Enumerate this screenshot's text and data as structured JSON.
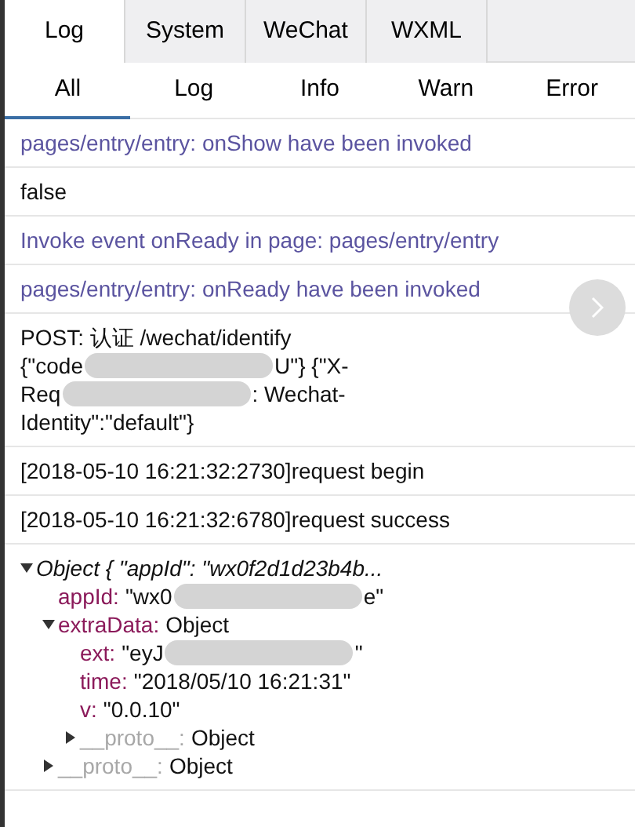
{
  "tabs": [
    {
      "label": "Log",
      "selected": true
    },
    {
      "label": "System",
      "selected": false
    },
    {
      "label": "WeChat",
      "selected": false
    },
    {
      "label": "WXML",
      "selected": false
    }
  ],
  "filters": [
    {
      "label": "All",
      "selected": true
    },
    {
      "label": "Log",
      "selected": false
    },
    {
      "label": "Info",
      "selected": false
    },
    {
      "label": "Warn",
      "selected": false
    },
    {
      "label": "Error",
      "selected": false
    }
  ],
  "logs": [
    {
      "kind": "info",
      "lines": [
        [
          {
            "kind": "text",
            "text": "pages/entry/entry: onShow have been invoked"
          }
        ]
      ]
    },
    {
      "kind": "plain",
      "lines": [
        [
          {
            "kind": "text",
            "text": "false"
          }
        ]
      ]
    },
    {
      "kind": "info",
      "lines": [
        [
          {
            "kind": "text",
            "text": "Invoke event onReady in page: pages/entry/entry"
          }
        ]
      ]
    },
    {
      "kind": "info",
      "lines": [
        [
          {
            "kind": "text",
            "text": "pages/entry/entry: onReady have been invoked"
          }
        ]
      ]
    },
    {
      "kind": "plain",
      "lines": [
        [
          {
            "kind": "text",
            "text": "POST: 认证 /wechat/identify"
          }
        ],
        [
          {
            "kind": "text",
            "text": "{\"code"
          },
          {
            "kind": "redacted"
          },
          {
            "kind": "text",
            "text": "U\"} {\"X-"
          }
        ],
        [
          {
            "kind": "text",
            "text": "Req"
          },
          {
            "kind": "redacted"
          },
          {
            "kind": "text",
            "text": ": Wechat-"
          }
        ],
        [
          {
            "kind": "text",
            "text": "Identity\":\"default\"}"
          }
        ]
      ]
    },
    {
      "kind": "plain",
      "lines": [
        [
          {
            "kind": "text",
            "text": "[2018-05-10 16:21:32:2730]request begin"
          }
        ]
      ]
    },
    {
      "kind": "plain",
      "lines": [
        [
          {
            "kind": "text",
            "text": "[2018-05-10 16:21:32:6780]request success"
          }
        ]
      ]
    },
    {
      "kind": "object",
      "summary": "Object { \"appId\": \"wx0f2d1d23b4b...",
      "expanded": true,
      "children": [
        {
          "kind": "prop",
          "key": "appId:",
          "value": [
            {
              "kind": "text",
              "text": "\"wx0"
            },
            {
              "kind": "redacted"
            },
            {
              "kind": "text",
              "text": "e\""
            }
          ]
        },
        {
          "kind": "prop",
          "key": "extraData:",
          "value": [
            {
              "kind": "text",
              "text": "Object"
            }
          ],
          "expanded": true,
          "children": [
            {
              "kind": "prop",
              "key": "ext:",
              "value": [
                {
                  "kind": "text",
                  "text": "\"eyJ"
                },
                {
                  "kind": "redacted"
                },
                {
                  "kind": "text",
                  "text": "\""
                }
              ]
            },
            {
              "kind": "prop",
              "key": "time:",
              "value": [
                {
                  "kind": "text",
                  "text": "\"2018/05/10 16:21:31\""
                }
              ]
            },
            {
              "kind": "prop",
              "key": "v:",
              "value": [
                {
                  "kind": "text",
                  "text": "\"0.0.10\""
                }
              ]
            },
            {
              "kind": "proto",
              "key": "__proto__:",
              "value": [
                {
                  "kind": "text",
                  "text": "Object"
                }
              ],
              "expanded": false
            }
          ]
        },
        {
          "kind": "proto",
          "key": "__proto__:",
          "value": [
            {
              "kind": "text",
              "text": "Object"
            }
          ],
          "expanded": false
        }
      ]
    }
  ]
}
